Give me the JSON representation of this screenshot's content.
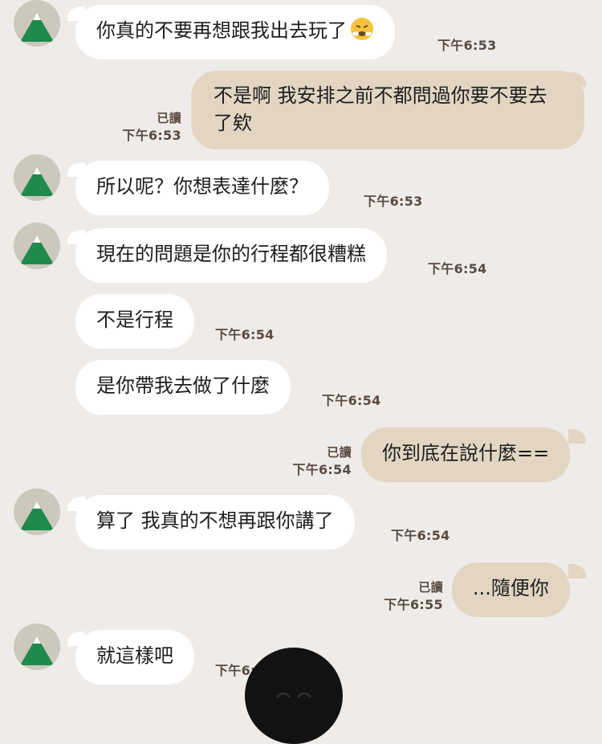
{
  "messages": [
    {
      "side": "in",
      "text": "你真的不要再想跟我出去玩了",
      "time": "下午6:53",
      "emoji": "face-with-steam-icon"
    },
    {
      "side": "out",
      "text": "不是啊 我安排之前不都問過你要不要去了欸",
      "time": "下午6:53",
      "read": "已讀"
    },
    {
      "side": "in",
      "text": "所以呢？你想表達什麼？",
      "time": "下午6:53"
    },
    {
      "side": "in",
      "text": "現在的問題是你的行程都很糟糕",
      "time": "下午6:54"
    },
    {
      "side": "in",
      "text": "不是行程",
      "time": "下午6:54"
    },
    {
      "side": "in",
      "text": "是你帶我去做了什麼",
      "time": "下午6:54"
    },
    {
      "side": "out",
      "text": "你到底在說什麼==",
      "time": "下午6:54",
      "read": "已讀"
    },
    {
      "side": "in",
      "text": "算了 我真的不想再跟你講了",
      "time": "下午6:54"
    },
    {
      "side": "out",
      "text": "...隨便你",
      "time": "下午6:55",
      "read": "已讀"
    },
    {
      "side": "in",
      "text": "就這樣吧",
      "time": "下午6:55"
    }
  ],
  "colors": {
    "background": "#eeebe8",
    "incoming_bubble": "#ffffff",
    "outgoing_bubble": "#e2d6c3",
    "meta_text": "#5a4a40",
    "avatar_mountain": "#1f8a4c"
  }
}
